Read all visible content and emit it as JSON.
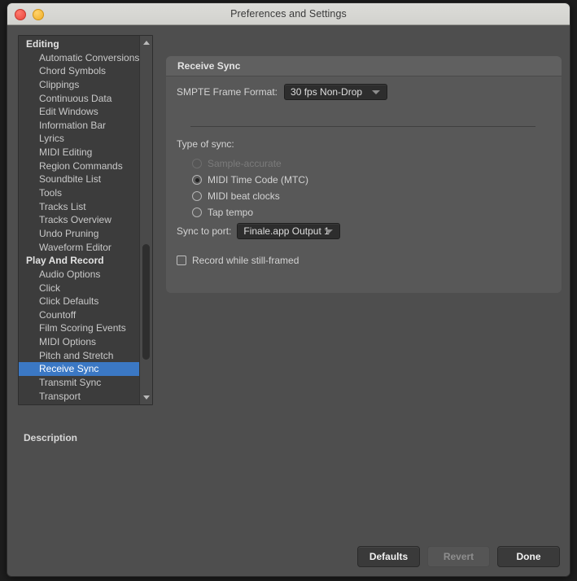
{
  "window": {
    "title": "Preferences and Settings",
    "traffic_lights": [
      {
        "name": "close-button",
        "color": "#e8463c"
      },
      {
        "name": "minimize-button",
        "color": "#f0ae28"
      }
    ]
  },
  "sidebar": {
    "selected": "Receive Sync",
    "items": [
      {
        "label": "Editing",
        "type": "group"
      },
      {
        "label": "Automatic Conversions",
        "type": "item"
      },
      {
        "label": "Chord Symbols",
        "type": "item"
      },
      {
        "label": "Clippings",
        "type": "item"
      },
      {
        "label": "Continuous Data",
        "type": "item"
      },
      {
        "label": "Edit Windows",
        "type": "item"
      },
      {
        "label": "Information Bar",
        "type": "item"
      },
      {
        "label": "Lyrics",
        "type": "item"
      },
      {
        "label": "MIDI Editing",
        "type": "item"
      },
      {
        "label": "Region Commands",
        "type": "item"
      },
      {
        "label": "Soundbite List",
        "type": "item"
      },
      {
        "label": "Tools",
        "type": "item"
      },
      {
        "label": "Tracks List",
        "type": "item"
      },
      {
        "label": "Tracks Overview",
        "type": "item"
      },
      {
        "label": "Undo Pruning",
        "type": "item"
      },
      {
        "label": "Waveform Editor",
        "type": "item"
      },
      {
        "label": "Play And Record",
        "type": "group"
      },
      {
        "label": "Audio Options",
        "type": "item"
      },
      {
        "label": "Click",
        "type": "item"
      },
      {
        "label": "Click Defaults",
        "type": "item"
      },
      {
        "label": "Countoff",
        "type": "item"
      },
      {
        "label": "Film Scoring Events",
        "type": "item"
      },
      {
        "label": "MIDI Options",
        "type": "item"
      },
      {
        "label": "Pitch and Stretch",
        "type": "item"
      },
      {
        "label": "Receive Sync",
        "type": "item",
        "selected": true
      },
      {
        "label": "Transmit Sync",
        "type": "item"
      },
      {
        "label": "Transport",
        "type": "item"
      }
    ]
  },
  "description": {
    "heading": "Description",
    "text": ""
  },
  "panel": {
    "header": "Receive Sync",
    "smpte": {
      "label": "SMPTE Frame Format:",
      "value": "30 fps Non-Drop"
    },
    "type_of_sync": {
      "label": "Type of sync:",
      "options": [
        {
          "label": "Sample-accurate",
          "checked": false,
          "disabled": true
        },
        {
          "label": "MIDI Time Code (MTC)",
          "checked": true,
          "disabled": false
        },
        {
          "label": "MIDI beat clocks",
          "checked": false,
          "disabled": false
        },
        {
          "label": "Tap tempo",
          "checked": false,
          "disabled": false
        }
      ]
    },
    "sync_to_port": {
      "label": "Sync to port:",
      "value": "Finale.app Output 1"
    },
    "record_still_framed": {
      "label": "Record while still-framed",
      "checked": false
    }
  },
  "footer": {
    "buttons": [
      {
        "label": "Defaults",
        "disabled": false
      },
      {
        "label": "Revert",
        "disabled": true
      },
      {
        "label": "Done",
        "disabled": false
      }
    ]
  },
  "colors": {
    "window_bg": "#4e4e4e",
    "panel_bg": "#585858",
    "sidebar_bg": "#3c3c3c",
    "selection_blue": "#3b78c4",
    "titlebar": "#d8d8d4"
  }
}
